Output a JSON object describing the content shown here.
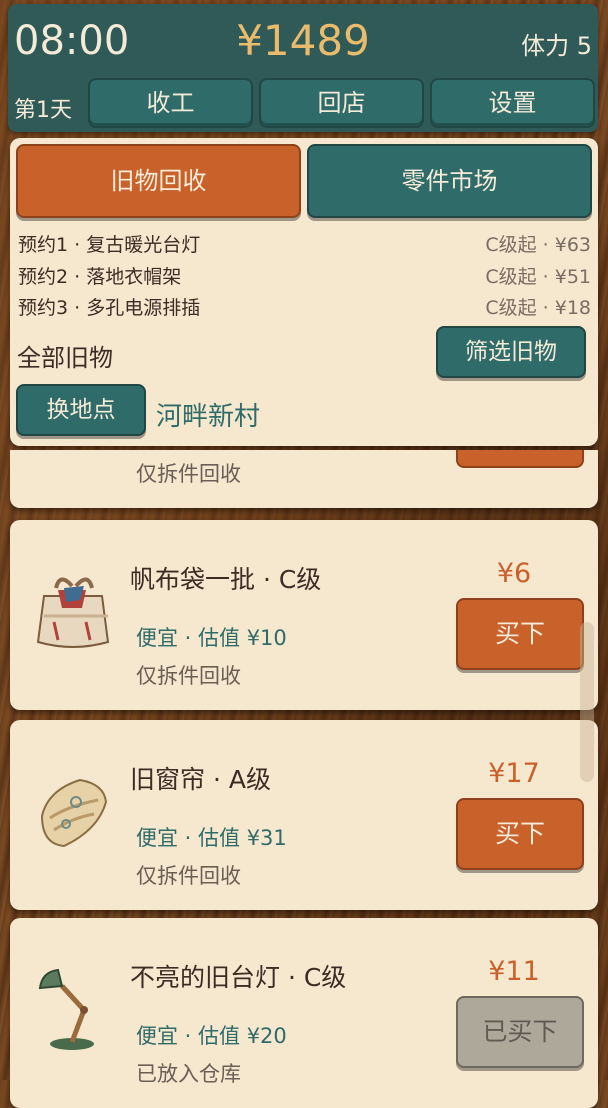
{
  "status": {
    "time": "08:00",
    "money": "¥1489",
    "stamina": "体力 5",
    "day": "第1天"
  },
  "nav": {
    "finish": "收工",
    "back_to_shop": "回店",
    "settings": "设置"
  },
  "tabs": {
    "recycle": "旧物回收",
    "parts_market": "零件市场"
  },
  "reservations": [
    {
      "label": "预约1 · 复古暖光台灯",
      "price": "C级起 · ¥63"
    },
    {
      "label": "预约2 · 落地衣帽架",
      "price": "C级起 · ¥51"
    },
    {
      "label": "预约3 · 多孔电源排插",
      "price": "C级起 · ¥18"
    }
  ],
  "filter": {
    "all_label": "全部旧物",
    "filter_button": "筛选旧物"
  },
  "location": {
    "switch_button": "换地点",
    "name": "河畔新村"
  },
  "partial_item": {
    "note": "仅拆件回收"
  },
  "items": [
    {
      "name": "帆布袋一批 · C级",
      "meta": "便宜 · 估值 ¥10",
      "note": "仅拆件回收",
      "price": "¥6",
      "button": "买下",
      "icon": "canvas-bag-icon"
    },
    {
      "name": "旧窗帘 · A级",
      "meta": "便宜 · 估值 ¥31",
      "note": "仅拆件回收",
      "price": "¥17",
      "button": "买下",
      "icon": "curtain-icon"
    },
    {
      "name": "不亮的旧台灯 · C级",
      "meta": "便宜 · 估值 ¥20",
      "note": "已放入仓库",
      "price": "¥11",
      "button": "已买下",
      "icon": "desk-lamp-icon"
    }
  ],
  "colors": {
    "teal": "#2f6b69",
    "orange": "#c8612a",
    "cream": "#f6e7cf",
    "gold": "#e9bb6c"
  }
}
